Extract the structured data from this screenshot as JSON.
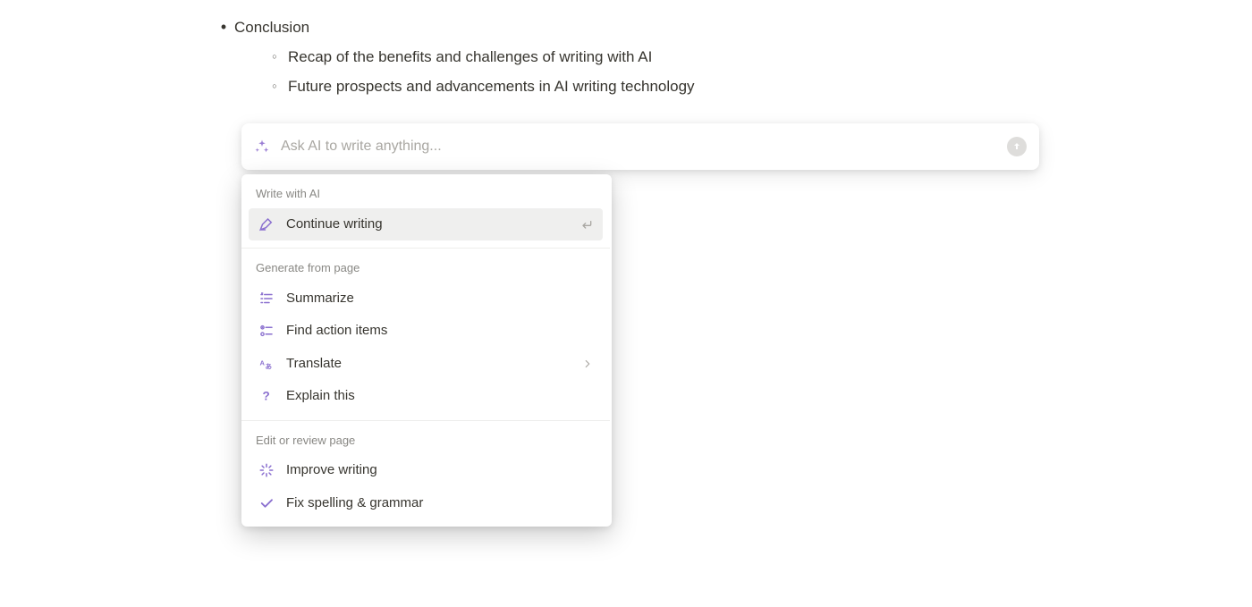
{
  "document": {
    "bullets": [
      {
        "text": "Conclusion",
        "children": [
          "Recap of the benefits and challenges of writing with AI",
          "Future prospects and advancements in AI writing technology"
        ]
      }
    ]
  },
  "ask_ai": {
    "placeholder": "Ask AI to write anything..."
  },
  "ai_menu": {
    "sections": [
      {
        "header": "Write with AI",
        "items": [
          {
            "icon": "pencil-line",
            "label": "Continue writing",
            "trail": "enter",
            "selected": true
          }
        ]
      },
      {
        "header": "Generate from page",
        "items": [
          {
            "icon": "summarize",
            "label": "Summarize"
          },
          {
            "icon": "action-items",
            "label": "Find action items"
          },
          {
            "icon": "translate",
            "label": "Translate",
            "trail": "chevron"
          },
          {
            "icon": "question",
            "label": "Explain this"
          }
        ]
      },
      {
        "header": "Edit or review page",
        "items": [
          {
            "icon": "sparkles-burst",
            "label": "Improve writing"
          },
          {
            "icon": "check",
            "label": "Fix spelling & grammar"
          }
        ]
      }
    ]
  },
  "colors": {
    "accent": "#8a6fcf",
    "text": "#37352f",
    "muted": "#898884"
  }
}
